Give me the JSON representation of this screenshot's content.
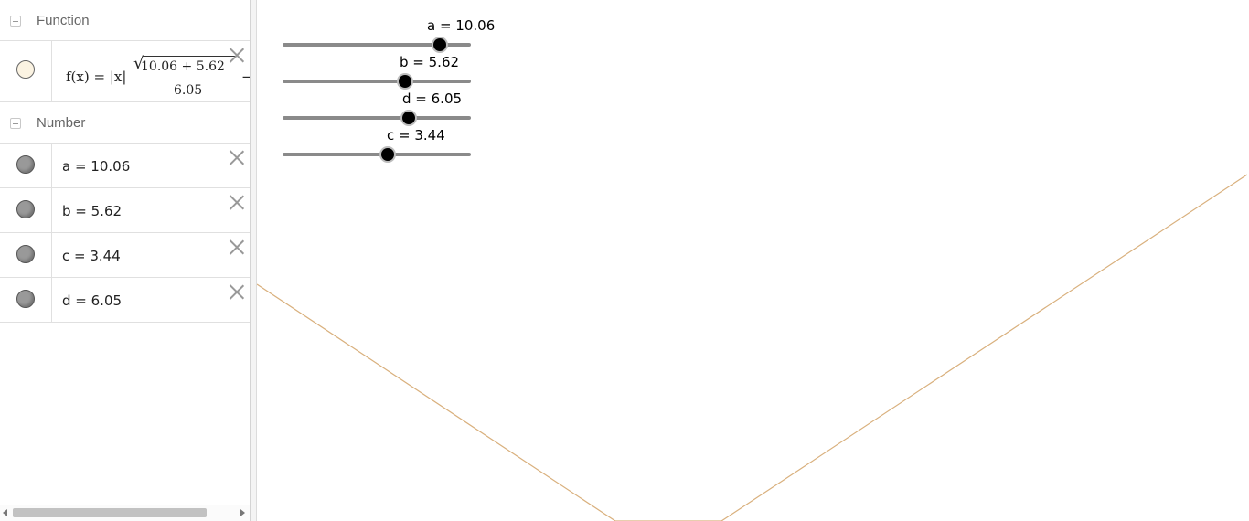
{
  "algebra": {
    "groups": {
      "function": {
        "label": "Function"
      },
      "number": {
        "label": "Number"
      }
    },
    "function_item": {
      "lhs": "f(x) = |x|",
      "numerator": "10.06 + 5.62",
      "radical": "√",
      "denominator": "6.05",
      "trailing": "−",
      "marble_color": "#fbf3e2"
    },
    "numbers": [
      {
        "def": "a = 10.06"
      },
      {
        "def": "b = 5.62"
      },
      {
        "def": "c = 3.44"
      },
      {
        "def": "d = 6.05"
      }
    ]
  },
  "sliders": [
    {
      "label": "a = 10.06",
      "value": 10.06,
      "min": -10,
      "max": 14
    },
    {
      "label": "b = 5.62",
      "value": 5.62,
      "min": -10,
      "max": 14
    },
    {
      "label": "d = 6.05",
      "value": 6.05,
      "min": -10,
      "max": 14
    },
    {
      "label": "c = 3.44",
      "value": 3.44,
      "min": -10,
      "max": 14
    }
  ],
  "graph": {
    "curve_color": "#d9b07d"
  }
}
